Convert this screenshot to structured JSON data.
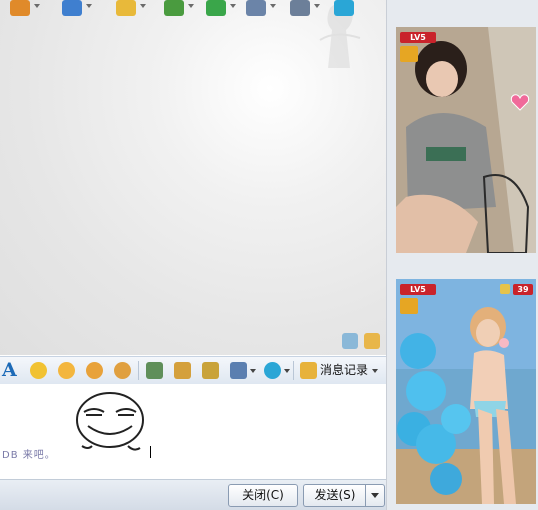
{
  "toolbar_top": {
    "buttons": [
      {
        "icon": "app-menu-icon",
        "color": "#e08a2a"
      },
      {
        "icon": "video-call-icon",
        "color": "#3f7fcf"
      },
      {
        "icon": "file-transfer-icon",
        "color": "#e8b93a"
      },
      {
        "icon": "screenshot-icon",
        "color": "#4a9b3f"
      },
      {
        "icon": "add-app-icon",
        "color": "#3aa64a"
      },
      {
        "icon": "remote-desktop-icon",
        "color": "#6b84a8"
      },
      {
        "icon": "settings-icon",
        "color": "#6c7f99"
      },
      {
        "icon": "soso-icon",
        "color": "#2aa6d6"
      }
    ]
  },
  "format_toolbar": {
    "font_label": "A",
    "history_label": "消息记录"
  },
  "input": {
    "sender_text": "DB  来吧。",
    "emoticon": "smug-face-emoticon"
  },
  "buttons": {
    "close_label": "关闭(C)",
    "send_label": "发送(S)"
  },
  "show_panel": {
    "top": {
      "level": "LV5"
    },
    "bottom": {
      "level": "LV5",
      "count": "39"
    }
  },
  "colors": {
    "accent_blue": "#1c6ab7",
    "level_red": "#c9232b",
    "panel_bg": "#e6eaef"
  }
}
